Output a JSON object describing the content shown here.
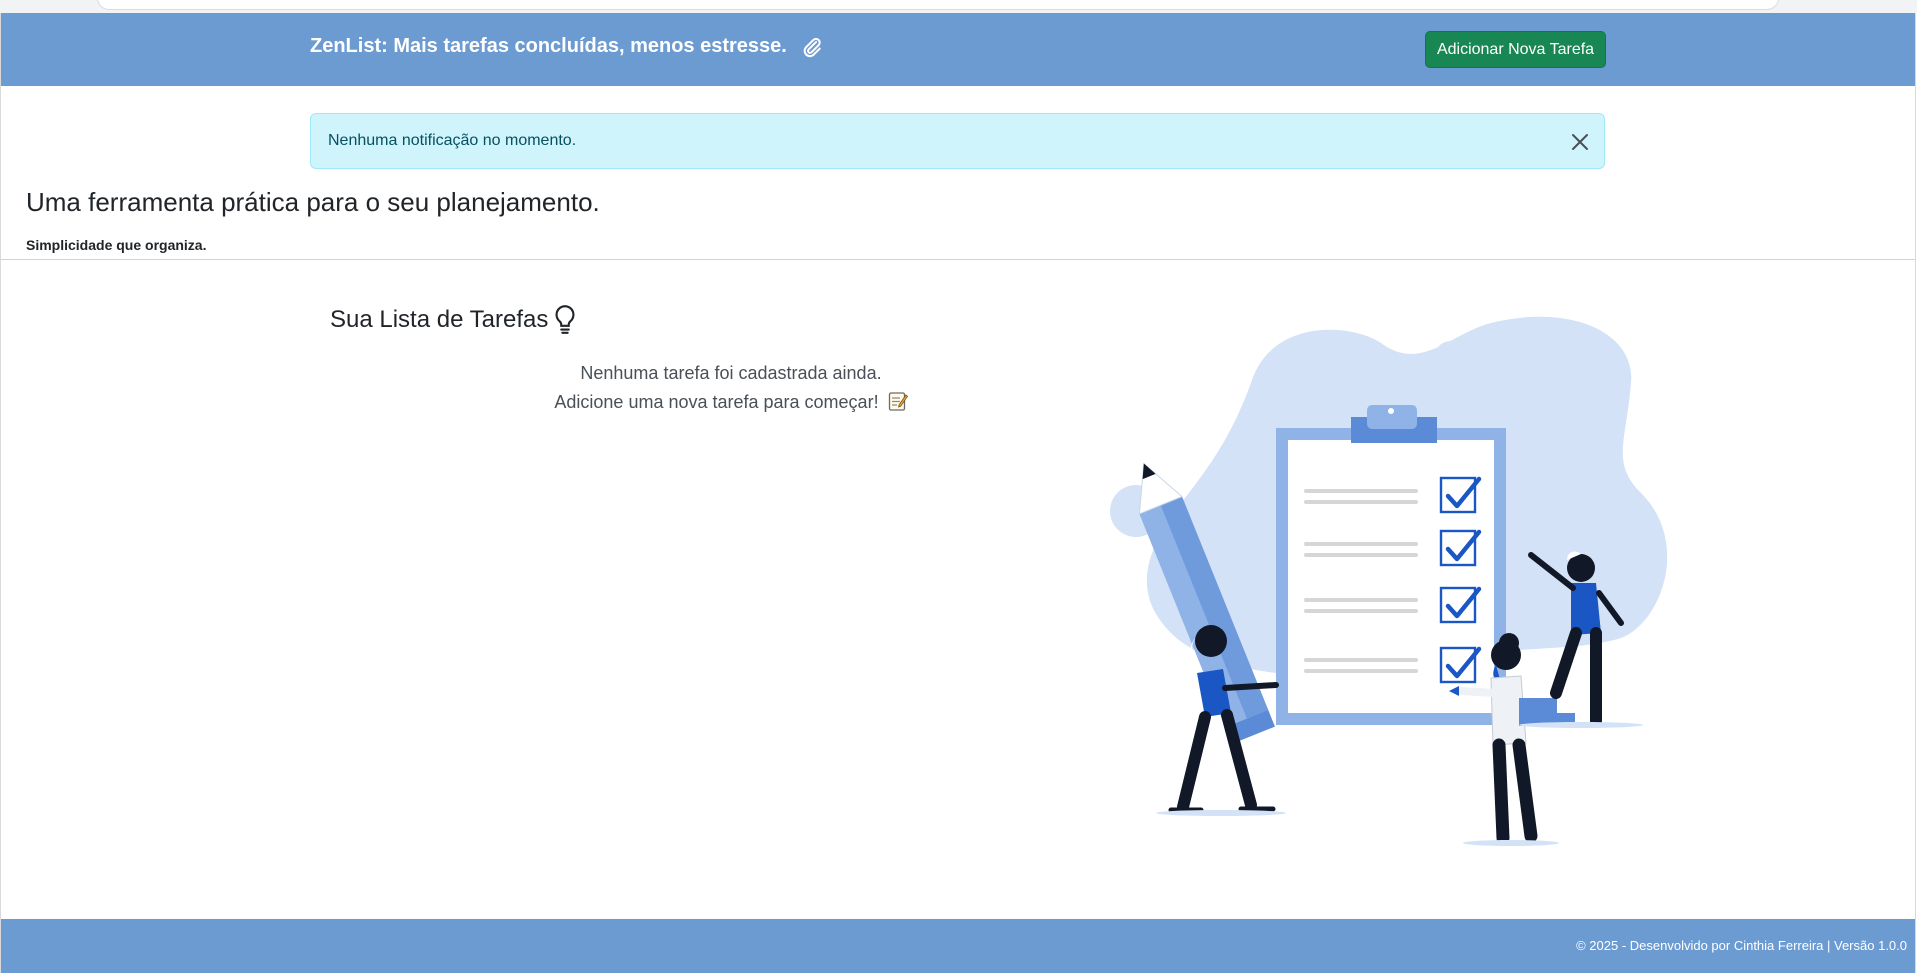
{
  "header": {
    "brand": "ZenList: Mais tarefas concluídas, menos estresse.",
    "brand_icon": "paperclip-icon",
    "add_task_label": "Adicionar Nova Tarefa"
  },
  "alert": {
    "message": "Nenhuma notificação no momento.",
    "close_icon": "close-icon"
  },
  "hero": {
    "title": "Uma ferramenta prática para o seu planejamento.",
    "subtitle": "Simplicidade que organiza."
  },
  "tasks": {
    "title": "Sua Lista de Tarefas",
    "title_icon": "lightbulb-icon",
    "empty_line1": "Nenhuma tarefa foi cadastrada ainda.",
    "empty_line2": "Adicione uma nova tarefa para começar!",
    "empty_icon": "memo-icon"
  },
  "footer": {
    "text": "© 2025 - Desenvolvido por Cinthia Ferreira | Versão 1.0.0"
  },
  "colors": {
    "header_bg": "#6c9bd2",
    "button_bg": "#198754",
    "alert_bg": "#cff4fc",
    "alert_text": "#055160",
    "illustration_blob": "#d3e2f7",
    "illustration_accent": "#1a56c4"
  }
}
